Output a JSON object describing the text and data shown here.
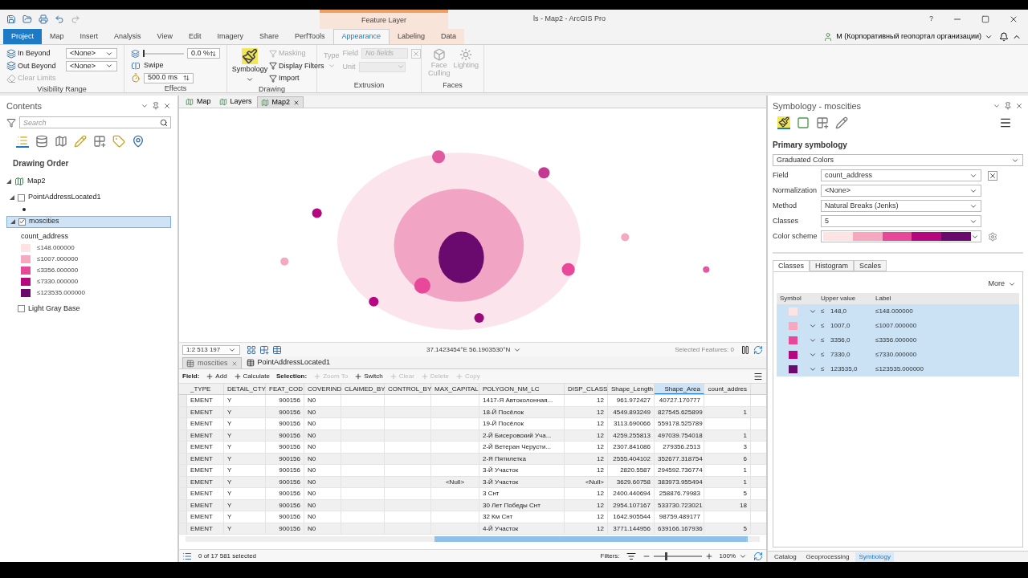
{
  "title_bar": {
    "context_group": "Feature Layer",
    "title": "ls - Map2 - ArcGIS Pro",
    "help": "?"
  },
  "tabs": [
    {
      "label": "Project",
      "kind": "file",
      "selected": false
    },
    {
      "label": "Map",
      "kind": "tab",
      "selected": false
    },
    {
      "label": "Insert",
      "kind": "tab",
      "selected": false
    },
    {
      "label": "Analysis",
      "kind": "tab",
      "selected": false
    },
    {
      "label": "View",
      "kind": "tab",
      "selected": false
    },
    {
      "label": "Edit",
      "kind": "tab",
      "selected": false
    },
    {
      "label": "Imagery",
      "kind": "tab",
      "selected": false
    },
    {
      "label": "Share",
      "kind": "tab",
      "selected": false
    },
    {
      "label": "PerfTools",
      "kind": "tab",
      "selected": false
    },
    {
      "label": "Appearance",
      "kind": "context",
      "selected": true
    },
    {
      "label": "Labeling",
      "kind": "context",
      "selected": false
    },
    {
      "label": "Data",
      "kind": "context",
      "selected": false
    }
  ],
  "user": "M (Корпоративный геопортал организации)",
  "ribbon": {
    "visibility_range": {
      "label": "Visibility Range",
      "in_beyond": {
        "label": "In Beyond",
        "value": "<None>"
      },
      "out_beyond": {
        "label": "Out Beyond",
        "value": "<None>"
      },
      "clear_limits": {
        "label": "Clear Limits",
        "disabled": true
      }
    },
    "effects": {
      "label": "Effects",
      "transparency": {
        "value": "0.0 %",
        "level": 0.0
      },
      "swipe": "Swipe",
      "flicker": "500.0 ms"
    },
    "drawing": {
      "label": "Drawing",
      "symbology": "Symbology",
      "items": [
        {
          "label": "Masking",
          "disabled": true
        },
        {
          "label": "Display Filters",
          "disabled": false
        },
        {
          "label": "Import",
          "disabled": false
        }
      ]
    },
    "extrusion": {
      "label": "Extrusion",
      "type": "Type",
      "field": {
        "label": "Field",
        "placeholder": "No fields"
      },
      "unit": "Unit"
    },
    "faces": {
      "label": "Faces",
      "face_culling": "Face Culling",
      "lighting": "Lighting"
    }
  },
  "contents": {
    "title": "Contents",
    "search": {
      "placeholder": "Search"
    },
    "heading": "Drawing Order",
    "map": {
      "name": "Map2",
      "expanded": true,
      "children": [
        {
          "name": "PointAddressLocated1",
          "checked": false,
          "selected": false,
          "expanded": true,
          "kind": "points"
        },
        {
          "name": "moscities",
          "checked": true,
          "selected": true,
          "expanded": true,
          "kind": "classes",
          "legend_field": "count_address",
          "classes": [
            {
              "label": "≤148.000000",
              "color": "#fde3e3"
            },
            {
              "label": "≤1007.000000",
              "color": "#f5a8bf"
            },
            {
              "label": "≤3356.000000",
              "color": "#e8489a"
            },
            {
              "label": "≤7330.000000",
              "color": "#b5077f"
            },
            {
              "label": "≤123535.000000",
              "color": "#6a0a6e"
            }
          ]
        },
        {
          "name": "Light Gray Base",
          "checked": false,
          "selected": false,
          "expanded": false,
          "kind": "basemap"
        }
      ]
    }
  },
  "map_view": {
    "tabs": [
      {
        "label": "Map",
        "selected": false
      },
      {
        "label": "Layers",
        "selected": false
      },
      {
        "label": "Map2",
        "selected": true
      }
    ],
    "scale": "1:2 513 197",
    "coordinates": "37.1423454°E 56.1903530°N",
    "selected_features": "Selected Features: 0"
  },
  "attribute_table": {
    "tabs": [
      {
        "label": "moscities",
        "selected": true
      },
      {
        "label": "PointAddressLocated1",
        "selected": false
      }
    ],
    "toolbar": [
      {
        "kind": "label",
        "label": "Field:"
      },
      {
        "kind": "button",
        "label": "Add",
        "disabled": false
      },
      {
        "kind": "button",
        "label": "Calculate",
        "disabled": false
      },
      {
        "kind": "label",
        "label": "Selection:"
      },
      {
        "kind": "button",
        "label": "Zoom To",
        "disabled": true
      },
      {
        "kind": "button",
        "label": "Switch",
        "disabled": false
      },
      {
        "kind": "button",
        "label": "Clear",
        "disabled": true
      },
      {
        "kind": "button",
        "label": "Delete",
        "disabled": true
      },
      {
        "kind": "button",
        "label": "Copy",
        "disabled": true
      }
    ],
    "columns": [
      {
        "label": "_TYPE",
        "kind": "text",
        "selected": false
      },
      {
        "label": "DETAIL_CTY",
        "kind": "text",
        "selected": false
      },
      {
        "label": "FEAT_COD",
        "kind": "number",
        "selected": false
      },
      {
        "label": "COVERIND",
        "kind": "text",
        "selected": false
      },
      {
        "label": "CLAIMED_BY",
        "kind": "text",
        "selected": false
      },
      {
        "label": "CONTROL_BY",
        "kind": "text",
        "selected": false
      },
      {
        "label": "MAX_CAPITAL",
        "kind": "center",
        "selected": false
      },
      {
        "label": "POLYGON_NM_LC",
        "kind": "text",
        "selected": false
      },
      {
        "label": "DISP_CLASS",
        "kind": "number",
        "selected": false
      },
      {
        "label": "Shape_Length",
        "kind": "number",
        "selected": false
      },
      {
        "label": "Shape_Area",
        "kind": "number",
        "selected": true
      },
      {
        "label": "count_addres",
        "kind": "number",
        "selected": false
      }
    ],
    "rows": [
      [
        "EMENT",
        "Y",
        "900156",
        "N0",
        "",
        "",
        "",
        "1417-Я Автоколонная...",
        "12",
        "961.972427",
        "40727.170777",
        ""
      ],
      [
        "EMENT",
        "Y",
        "900156",
        "N0",
        "",
        "",
        "",
        "18-Й Посёлок",
        "12",
        "4549.893249",
        "827545.625899",
        "1"
      ],
      [
        "EMENT",
        "Y",
        "900156",
        "N0",
        "",
        "",
        "",
        "19-Й Посёлок",
        "12",
        "3113.690066",
        "559178.525789",
        ""
      ],
      [
        "EMENT",
        "Y",
        "900156",
        "N0",
        "",
        "",
        "",
        "2-Й Бисеровский Уча...",
        "12",
        "4259.255813",
        "497039.754018",
        "1"
      ],
      [
        "EMENT",
        "Y",
        "900156",
        "N0",
        "",
        "",
        "",
        "2-Й Ветеран Черусти...",
        "12",
        "2307.841086",
        "279356.2513",
        "3"
      ],
      [
        "EMENT",
        "Y",
        "900156",
        "N0",
        "",
        "",
        "",
        "2-Я Пятилетка",
        "12",
        "2555.404102",
        "352677.318754",
        "6"
      ],
      [
        "EMENT",
        "Y",
        "900156",
        "N0",
        "",
        "",
        "",
        "3-Й Участок",
        "12",
        "2820.5587",
        "294592.736774",
        "1"
      ],
      [
        "EMENT",
        "Y",
        "900156",
        "N0",
        "",
        "",
        "<Null>",
        "3-Й Участок",
        "<Null>",
        "3629.60758",
        "383973.955494",
        "1"
      ],
      [
        "EMENT",
        "Y",
        "900156",
        "N0",
        "",
        "",
        "",
        "3 Снт",
        "12",
        "2400.440694",
        "258876.79983",
        "5"
      ],
      [
        "EMENT",
        "Y",
        "900156",
        "N0",
        "",
        "",
        "",
        "30 Лет Победы Снт",
        "12",
        "2954.107167",
        "533730.723021",
        "18"
      ],
      [
        "EMENT",
        "Y",
        "900156",
        "N0",
        "",
        "",
        "",
        "32 Км Снт",
        "12",
        "1642.905544",
        "98759.489177",
        ""
      ],
      [
        "EMENT",
        "Y",
        "900156",
        "N0",
        "",
        "",
        "",
        "4-Й Участок",
        "12",
        "3771.144956",
        "639166.167936",
        "5"
      ]
    ],
    "footer": {
      "selected": "0 of 17 581 selected",
      "filters": "Filters:",
      "zoom_slider": {
        "level": 0.25
      },
      "zoom": "100%"
    }
  },
  "symbology": {
    "title": "Symbology - moscities",
    "heading": "Primary symbology",
    "type": "Graduated Colors",
    "fields": [
      {
        "label": "Field",
        "value": "count_address",
        "kind": "field"
      },
      {
        "label": "Normalization",
        "value": "<None>",
        "kind": "select"
      },
      {
        "label": "Method",
        "value": "Natural Breaks (Jenks)",
        "kind": "select"
      },
      {
        "label": "Classes",
        "value": "5",
        "kind": "select"
      },
      {
        "label": "Color scheme",
        "kind": "scheme",
        "colors": [
          {
            "color": "#fde3e3"
          },
          {
            "color": "#f5a8bf"
          },
          {
            "color": "#e8489a"
          },
          {
            "color": "#b5077f"
          },
          {
            "color": "#6a0a6e"
          }
        ]
      }
    ],
    "tabs": [
      {
        "label": "Classes",
        "selected": true
      },
      {
        "label": "Histogram",
        "selected": false
      },
      {
        "label": "Scales",
        "selected": false
      }
    ],
    "more": "More",
    "columns": [
      "Symbol",
      "Upper value",
      "Label"
    ],
    "classes": [
      {
        "color": "#fde3e3",
        "op": "≤",
        "upper": "148,0",
        "label": "≤148.000000",
        "selected": true
      },
      {
        "color": "#f5a8bf",
        "op": "≤",
        "upper": "1007,0",
        "label": "≤1007.000000",
        "selected": true
      },
      {
        "color": "#e8489a",
        "op": "≤",
        "upper": "3356,0",
        "label": "≤3356.000000",
        "selected": true
      },
      {
        "color": "#b5077f",
        "op": "≤",
        "upper": "7330,0",
        "label": "≤7330.000000",
        "selected": true
      },
      {
        "color": "#6a0a6e",
        "op": "≤",
        "upper": "123535,0",
        "label": "≤123535.000000",
        "selected": true
      }
    ]
  },
  "dock_tabs": [
    {
      "label": "Catalog",
      "selected": false
    },
    {
      "label": "Geoprocessing",
      "selected": false
    },
    {
      "label": "Symbology",
      "selected": true
    }
  ]
}
